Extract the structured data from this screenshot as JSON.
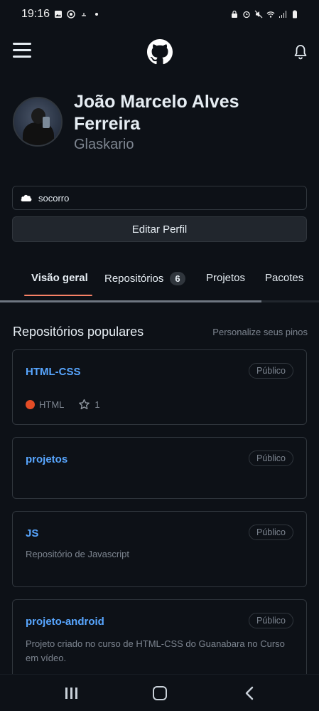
{
  "statusbar": {
    "time": "19:16"
  },
  "profile": {
    "name": "João Marcelo Alves Ferreira",
    "login": "Glaskario",
    "status_text": "socorro"
  },
  "actions": {
    "edit_profile": "Editar Perfil"
  },
  "tabs": [
    {
      "label": "Visão geral",
      "active": true
    },
    {
      "label": "Repositórios",
      "count": "6"
    },
    {
      "label": "Projetos"
    },
    {
      "label": "Pacotes"
    }
  ],
  "popular": {
    "title": "Repositórios populares",
    "customize_link": "Personalize seus pinos"
  },
  "repos": [
    {
      "name": "HTML-CSS",
      "visibility": "Público",
      "language": "HTML",
      "language_color": "#e34c26",
      "stars": "1",
      "description": ""
    },
    {
      "name": "projetos",
      "visibility": "Público",
      "description": ""
    },
    {
      "name": "JS",
      "visibility": "Público",
      "description": "Repositório de Javascript"
    },
    {
      "name": "projeto-android",
      "visibility": "Público",
      "description": "Projeto criado no curso de HTML-CSS do Guanabara no Curso em vídeo."
    }
  ],
  "icons": {
    "menu": "hamburger-menu-icon",
    "logo": "github-logo-icon",
    "bell": "bell-icon",
    "status": "cloud-emoji-icon",
    "star": "star-icon",
    "nav_recent": "recent-apps-icon",
    "nav_home": "home-icon",
    "nav_back": "back-icon"
  }
}
